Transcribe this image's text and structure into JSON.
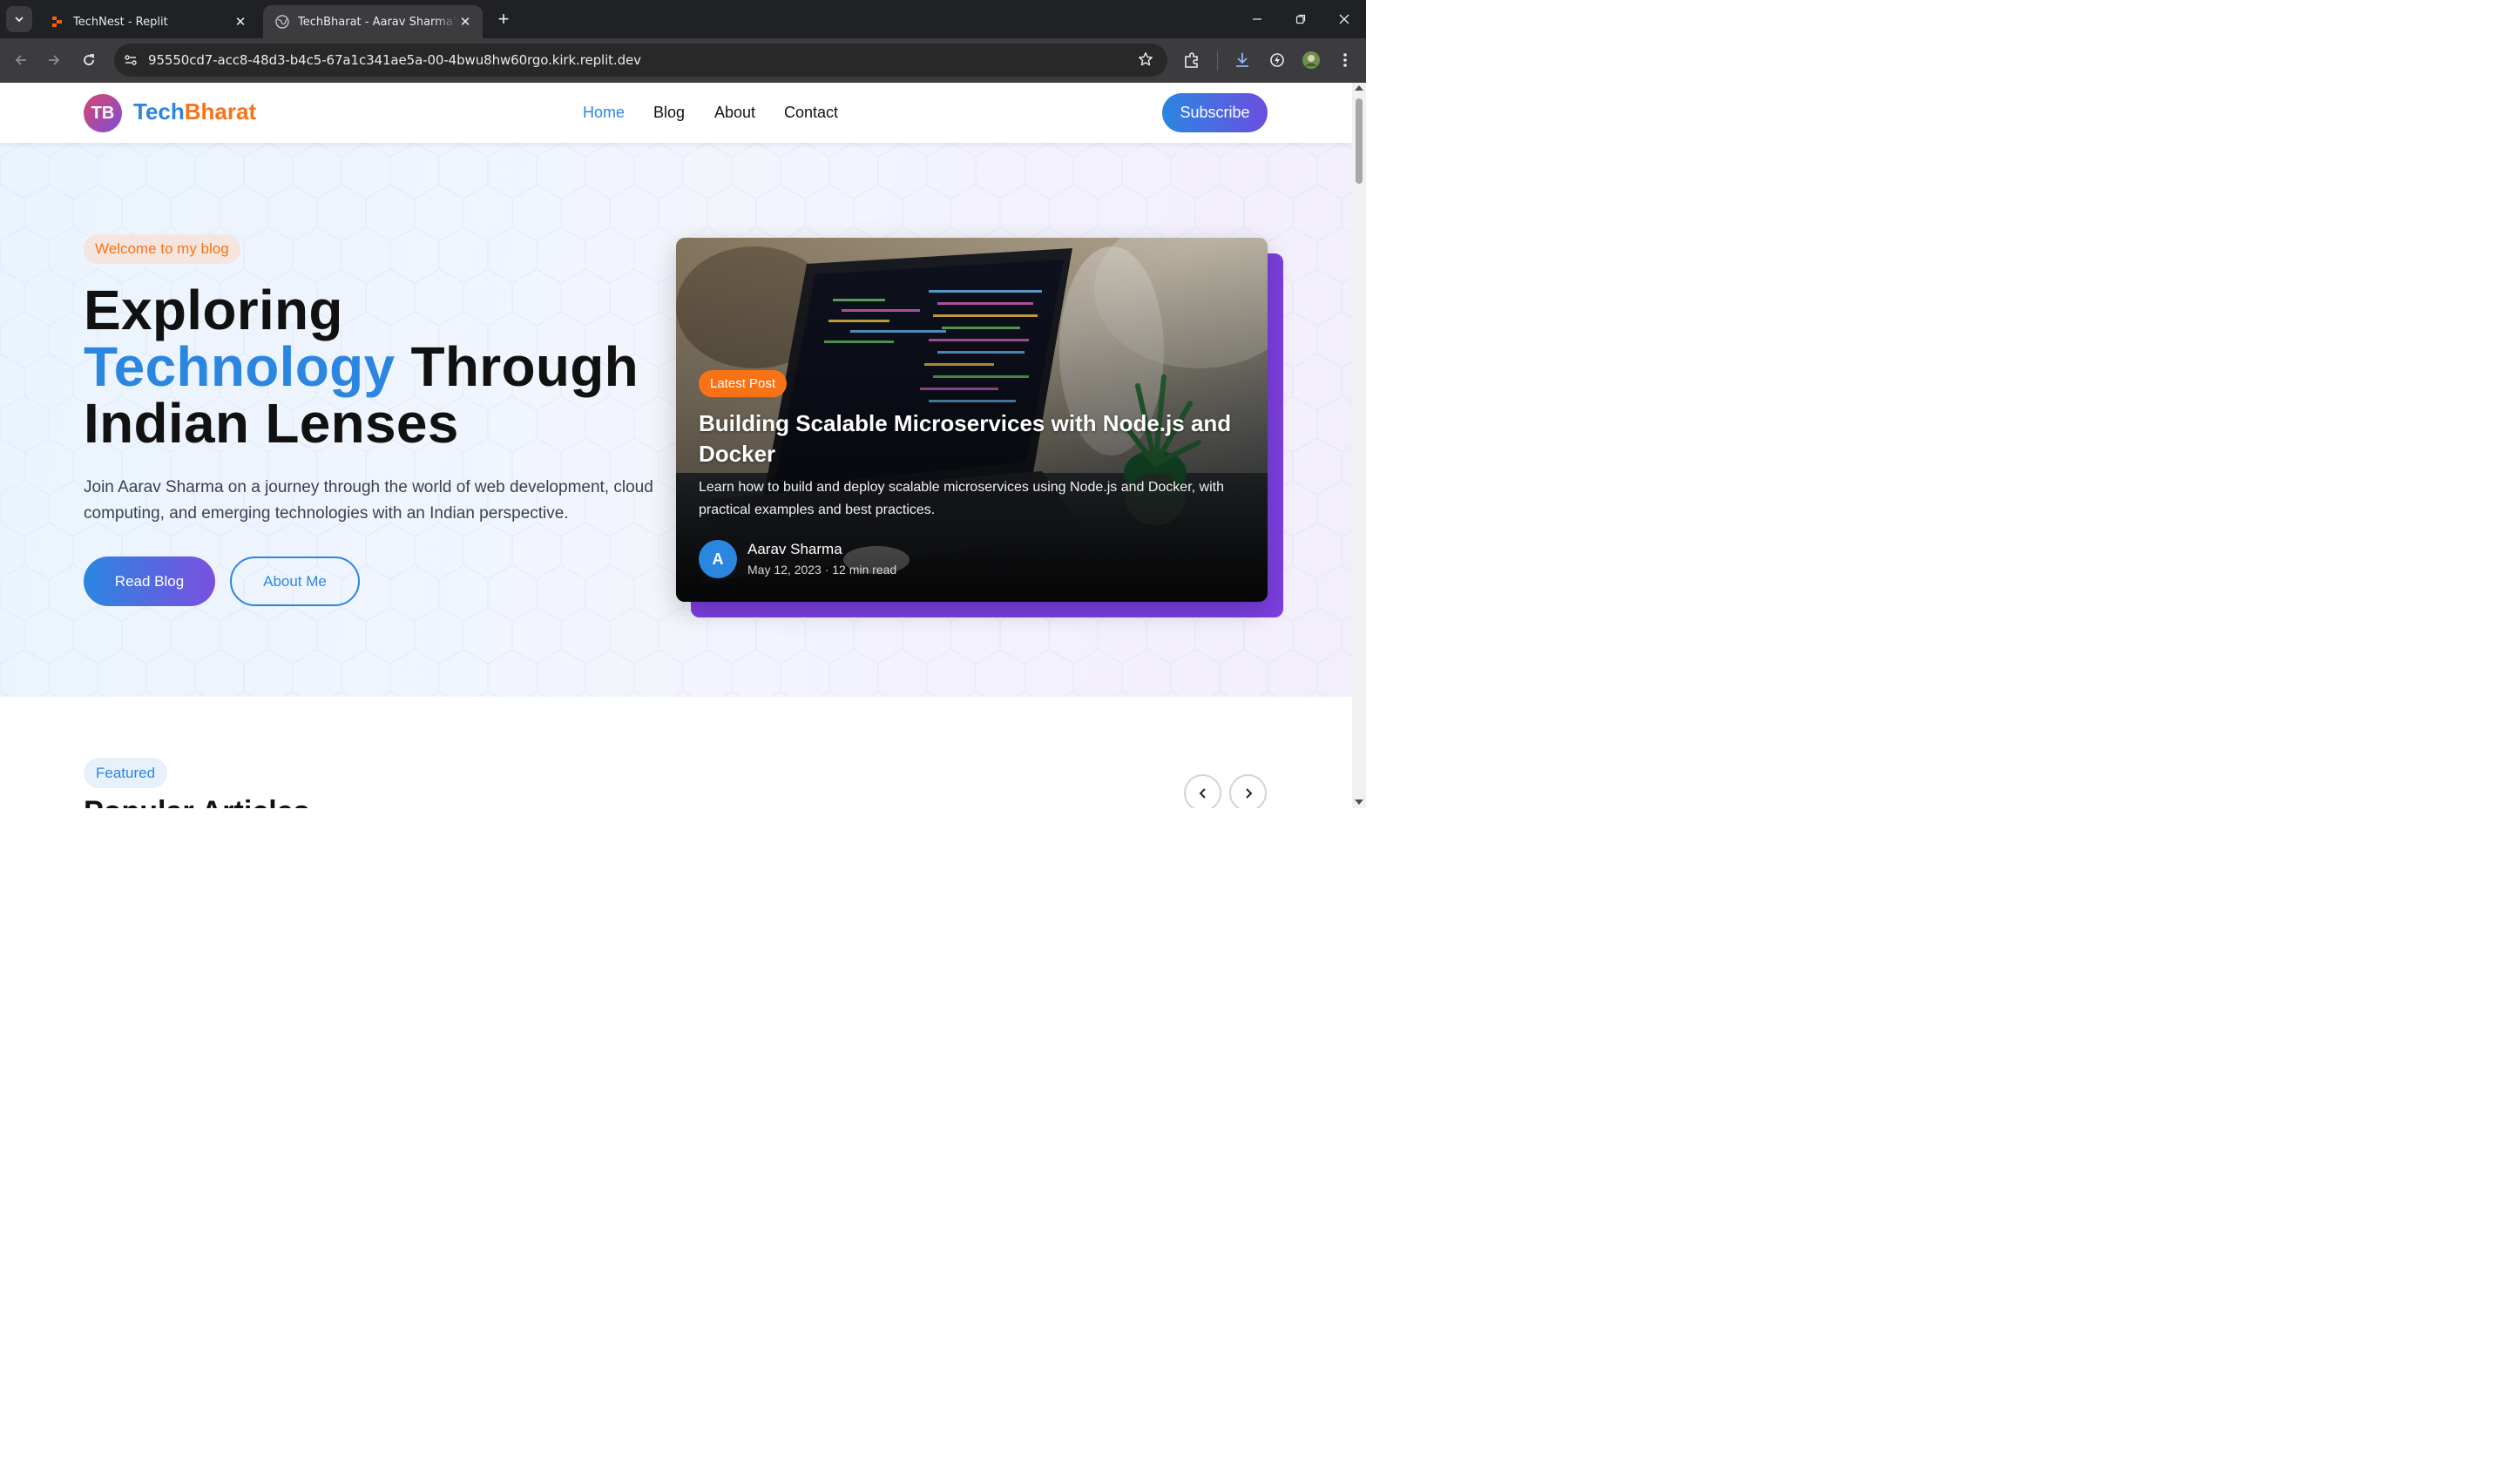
{
  "browser": {
    "tabs": [
      {
        "title": "TechNest - Replit",
        "active": false
      },
      {
        "title": "TechBharat - Aarav Sharma's Tech Blog",
        "active": true
      }
    ],
    "url": "95550cd7-acc8-48d3-b4c5-67a1c341ae5a-00-4bwu8hw60rgo.kirk.replit.dev"
  },
  "site": {
    "logo_initials": "TB",
    "brand_part1": "Tech",
    "brand_part2": "Bharat",
    "nav": [
      "Home",
      "Blog",
      "About",
      "Contact"
    ],
    "active_nav": "Home",
    "subscribe_label": "Subscribe"
  },
  "hero": {
    "pill": "Welcome to my blog",
    "title_line1": "Exploring",
    "title_highlight": "Technology",
    "title_line2_rest": " Through",
    "title_line3": "Indian Lenses",
    "description": "Join Aarav Sharma on a journey through the world of web development, cloud computing, and emerging technologies with an Indian perspective.",
    "primary_button": "Read Blog",
    "secondary_button": "About Me"
  },
  "latest_post": {
    "badge": "Latest Post",
    "title": "Building Scalable Microservices with Node.js and Docker",
    "excerpt": "Learn how to build and deploy scalable microservices using Node.js and Docker, with practical examples and best practices.",
    "author_initial": "A",
    "author": "Aarav Sharma",
    "meta": "May 12, 2023 · 12 min read"
  },
  "featured": {
    "pill": "Featured",
    "title": "Popular Articles"
  },
  "colors": {
    "primary": "#2b86e0",
    "accent": "#f97316",
    "purple": "#7c3fe0"
  }
}
